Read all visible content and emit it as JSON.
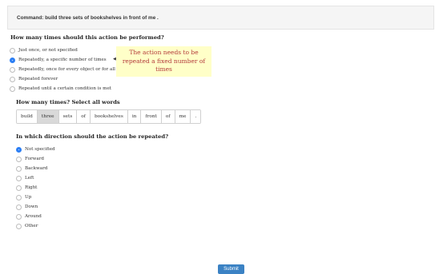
{
  "command": "Command: build three sets of bookshelves in front of me .",
  "q1": {
    "title": "How many times should this action be performed?",
    "options": [
      {
        "label": "Just once, or not specified",
        "selected": false
      },
      {
        "label": "Repeatedly, a specific number of times",
        "selected": true
      },
      {
        "label": "Repeatedly, once for every object or for all objects",
        "selected": false
      },
      {
        "label": "Repeated forever",
        "selected": false
      },
      {
        "label": "Repeated until a certain condition is met",
        "selected": false
      }
    ]
  },
  "tooltip": {
    "line1": "The action needs to be",
    "line2": "repeated a fixed number of",
    "line3": "times",
    "arrow": "◀"
  },
  "q2": {
    "title": "How many times? Select all words",
    "words": [
      {
        "text": "build",
        "selected": false
      },
      {
        "text": "three",
        "selected": true
      },
      {
        "text": "sets",
        "selected": false
      },
      {
        "text": "of",
        "selected": false
      },
      {
        "text": "bookshelves",
        "selected": false
      },
      {
        "text": "in",
        "selected": false
      },
      {
        "text": "front",
        "selected": false
      },
      {
        "text": "of",
        "selected": false
      },
      {
        "text": "me",
        "selected": false
      },
      {
        "text": ".",
        "selected": false
      }
    ]
  },
  "q3": {
    "title": "In which direction should the action be repeated?",
    "options": [
      {
        "label": "Not specified",
        "selected": true
      },
      {
        "label": "Forward",
        "selected": false
      },
      {
        "label": "Backward",
        "selected": false
      },
      {
        "label": "Left",
        "selected": false
      },
      {
        "label": "Right",
        "selected": false
      },
      {
        "label": "Up",
        "selected": false
      },
      {
        "label": "Down",
        "selected": false
      },
      {
        "label": "Around",
        "selected": false
      },
      {
        "label": "Other",
        "selected": false
      }
    ]
  },
  "submit_label": "Submit",
  "colors": {
    "accent": "#2d7ff4",
    "tooltip_bg": "#ffffc8",
    "tooltip_text": "#b33a3a",
    "submit_bg": "#3b82c4"
  }
}
